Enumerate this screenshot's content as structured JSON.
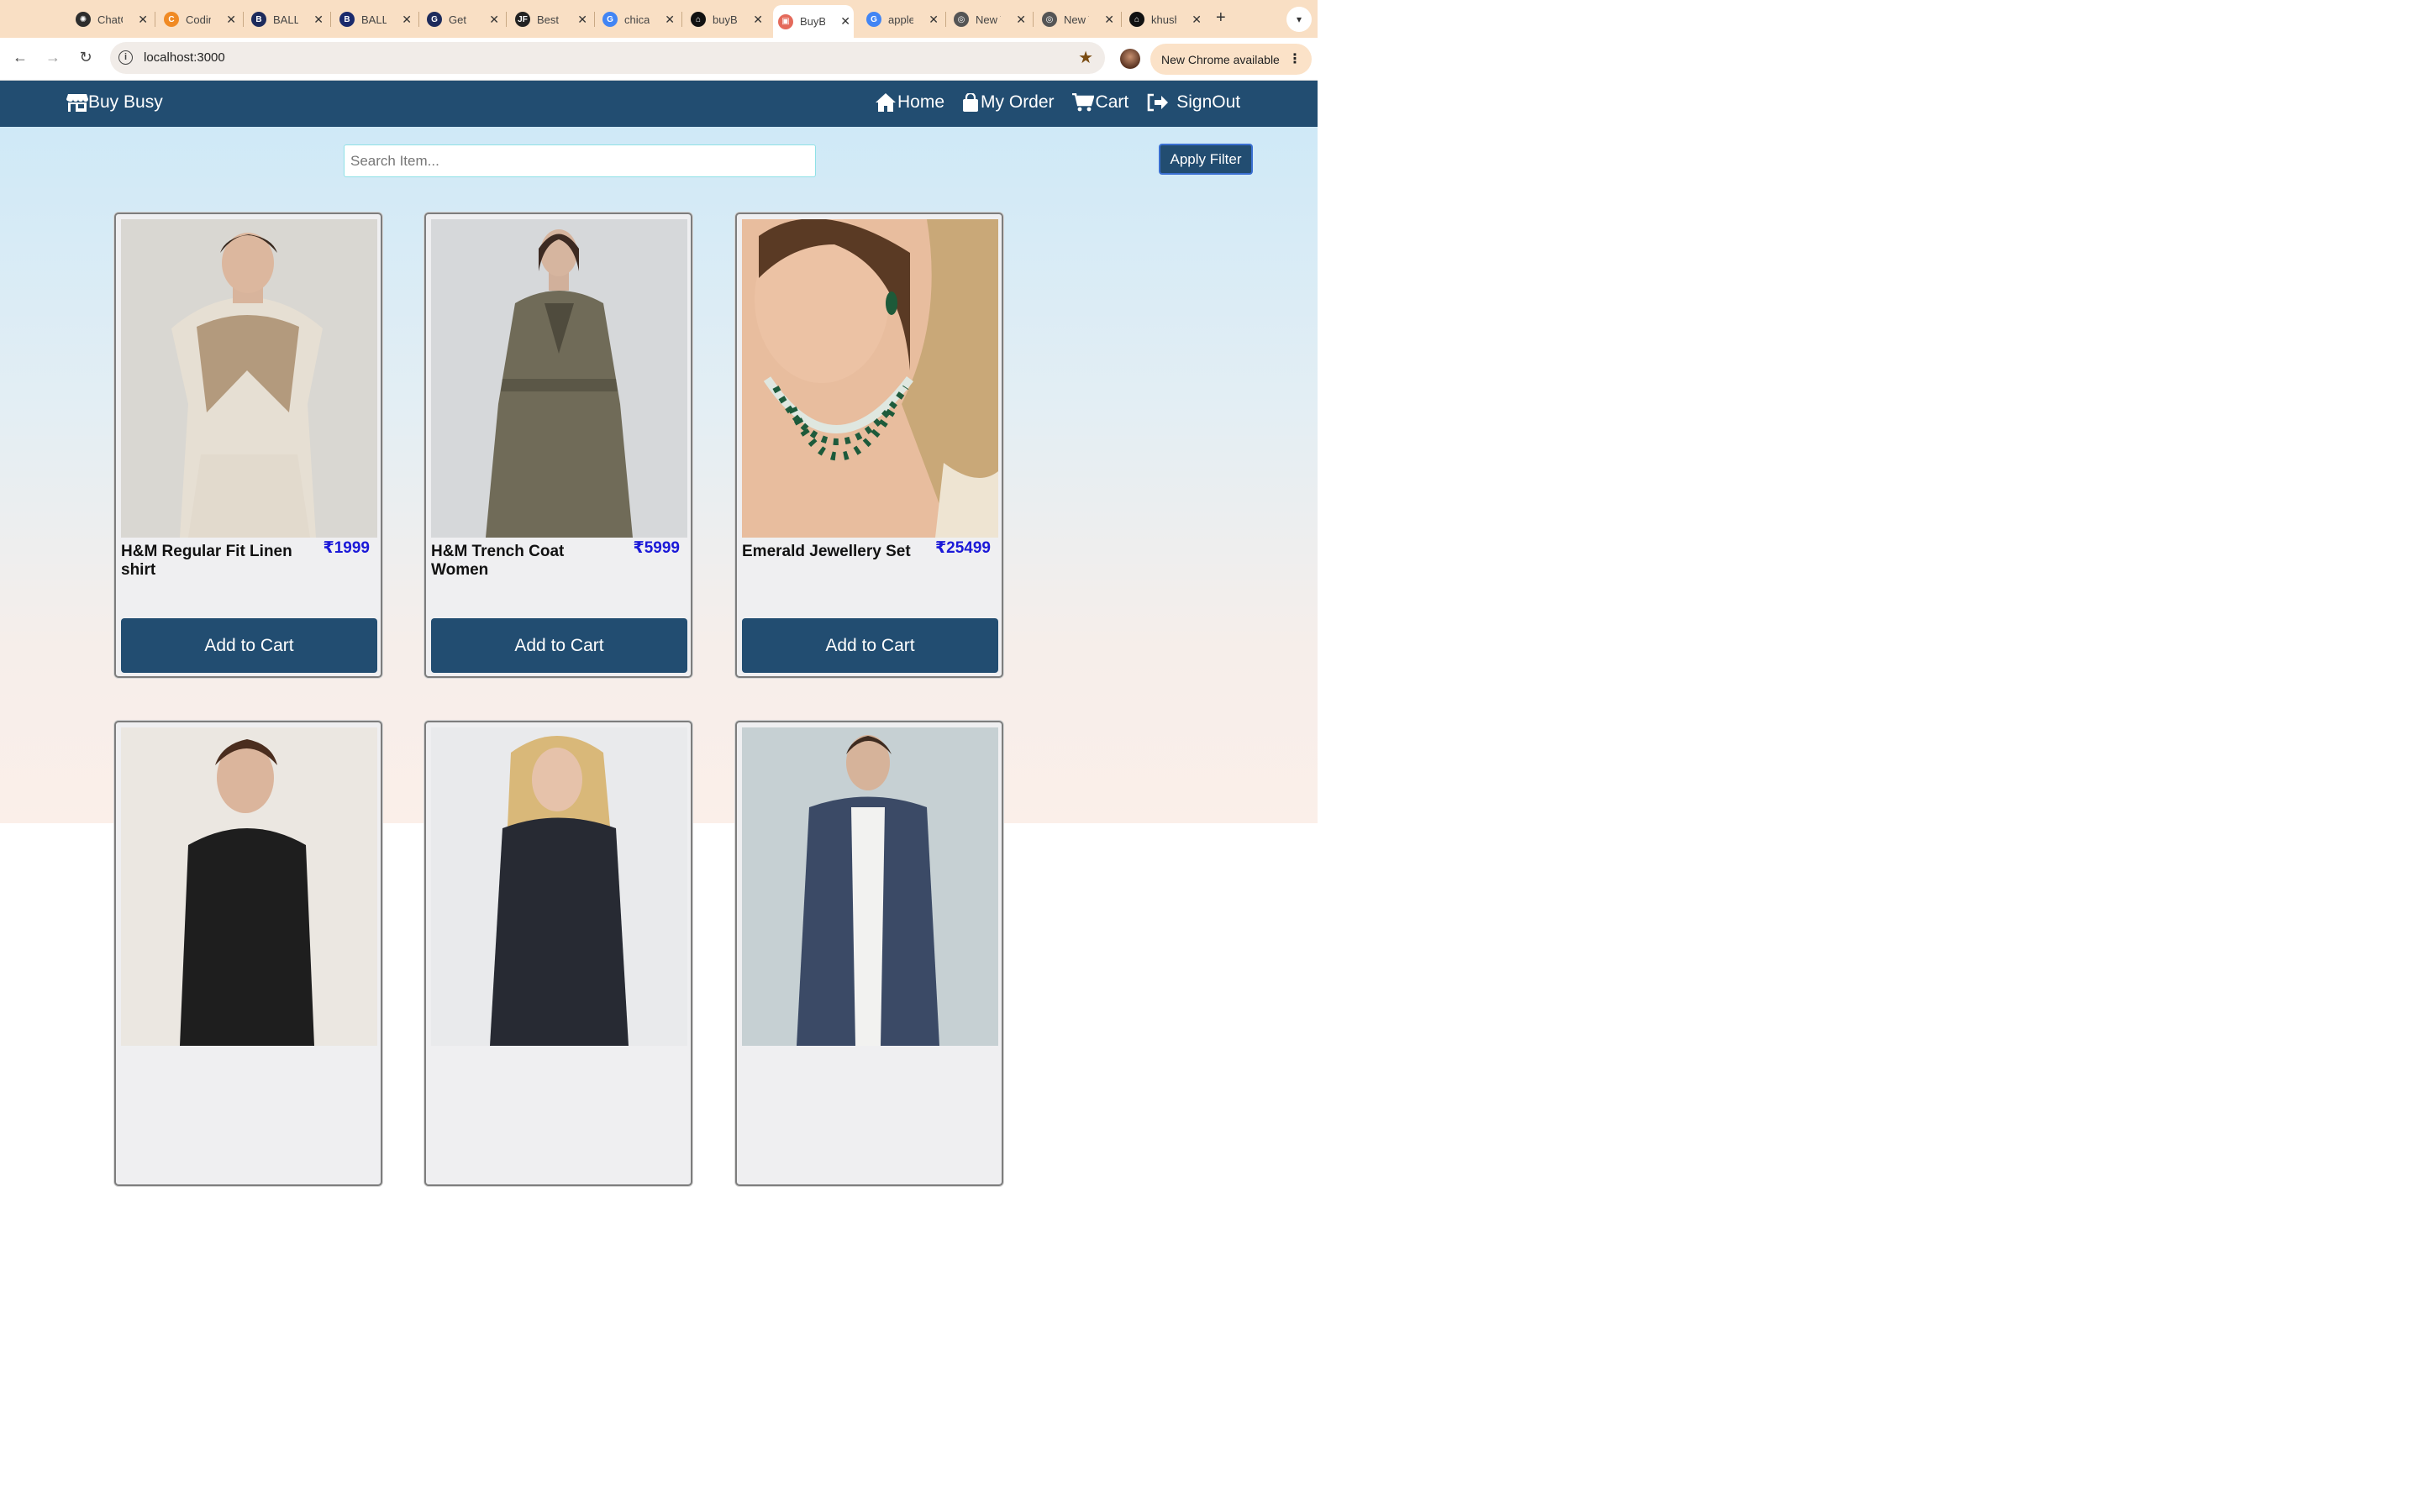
{
  "browser": {
    "tabs": [
      {
        "title": "ChatGPT",
        "fav_color": "#2d2d2d",
        "fav_glyph": "✺"
      },
      {
        "title": "Coding Ninjas",
        "fav_color": "#f08a24",
        "fav_glyph": "C"
      },
      {
        "title": "BALLERINA",
        "fav_color": "#1d2b5c",
        "fav_glyph": "B"
      },
      {
        "title": "BALLERINA",
        "fav_color": "#1a2a6c",
        "fav_glyph": "B"
      },
      {
        "title": "Get",
        "fav_color": "#1d2b5c",
        "fav_glyph": "G"
      },
      {
        "title": "Best",
        "fav_color": "#222222",
        "fav_glyph": "JF"
      },
      {
        "title": "chicago",
        "fav_color": "#4285f4",
        "fav_glyph": "G"
      },
      {
        "title": "buyBusy",
        "fav_color": "#111111",
        "fav_glyph": "⌂"
      },
      {
        "title": "BuyBusy",
        "fav_color": "#e46a5b",
        "fav_glyph": "▣"
      },
      {
        "title": "apple",
        "fav_color": "#4285f4",
        "fav_glyph": "G"
      },
      {
        "title": "New Tab",
        "fav_color": "#555555",
        "fav_glyph": "◎"
      },
      {
        "title": "New Tab",
        "fav_color": "#555555",
        "fav_glyph": "◎"
      },
      {
        "title": "khushi",
        "fav_color": "#111111",
        "fav_glyph": "⌂"
      }
    ],
    "active_tab_index": 8,
    "url": "localhost:3000",
    "update_label": "New Chrome available"
  },
  "app": {
    "brand": "Buy Busy",
    "nav": {
      "home": "Home",
      "orders": "My Order",
      "cart": "Cart",
      "signout": "SignOut"
    },
    "search_placeholder": "Search Item...",
    "filter_label": "Apply Filter",
    "add_label": "Add to Cart",
    "products": [
      {
        "name": "H&M Regular Fit Linen shirt",
        "price": "₹1999"
      },
      {
        "name": "H&M Trench Coat Women",
        "price": "₹5999"
      },
      {
        "name": "Emerald Jewellery Set",
        "price": "₹25499"
      }
    ]
  },
  "colors": {
    "nav": "#224d71",
    "price": "#1b19d8",
    "tabstrip": "#f9dfc4"
  }
}
